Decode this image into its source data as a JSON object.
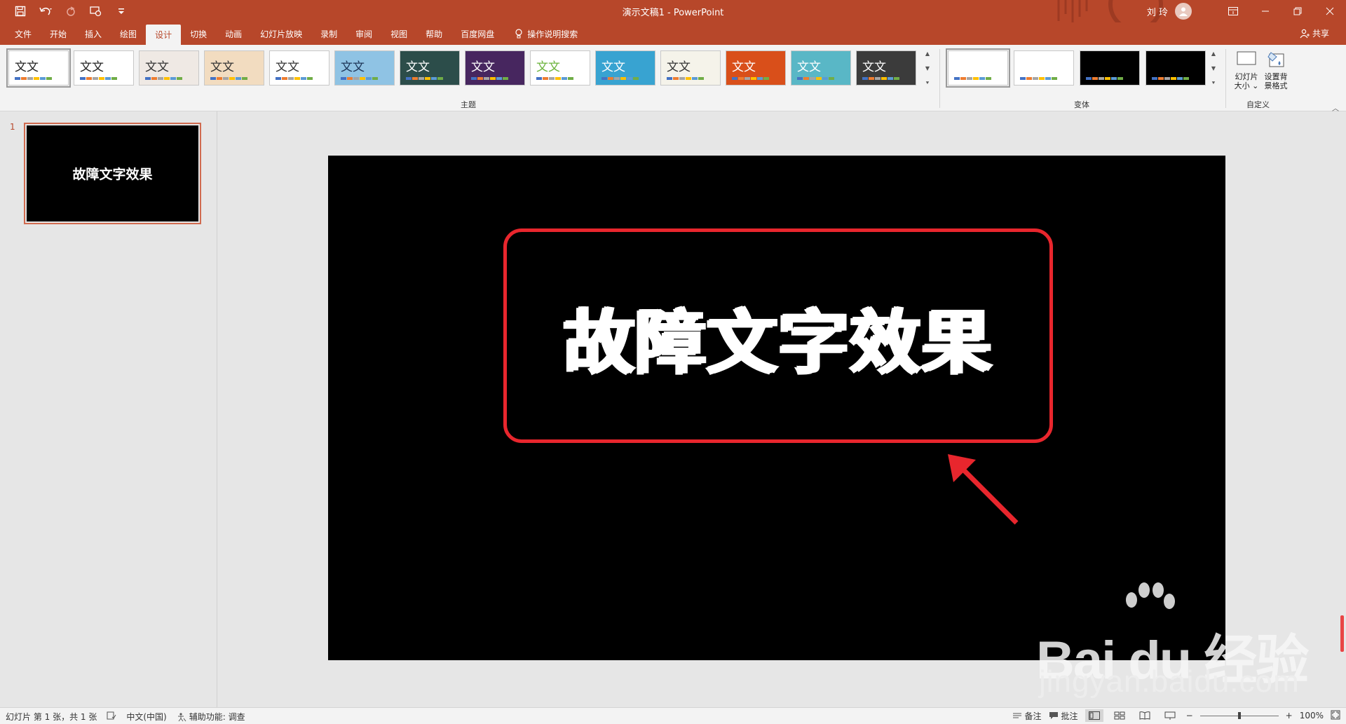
{
  "titlebar": {
    "doc_title": "演示文稿1  -  PowerPoint",
    "user_name": "刘 玲",
    "qat_icons": [
      "save-icon",
      "undo-icon",
      "redo-icon",
      "touch-mode-icon",
      "customize-qat-icon"
    ],
    "window_controls": [
      "ribbon-display-options-icon",
      "minimize-icon",
      "restore-icon",
      "close-icon"
    ]
  },
  "tabs": {
    "items": [
      "文件",
      "开始",
      "插入",
      "绘图",
      "设计",
      "切换",
      "动画",
      "幻灯片放映",
      "录制",
      "审阅",
      "视图",
      "帮助",
      "百度网盘"
    ],
    "active_index": 4,
    "tell_me": "操作说明搜索",
    "share": "共享"
  },
  "ribbon": {
    "themes_group_label": "主题",
    "variants_group_label": "变体",
    "customize_group_label": "自定义",
    "slide_size_label_line1": "幻灯片",
    "slide_size_label_line2": "大小",
    "format_bg_label_line1": "设置背",
    "format_bg_label_line2": "景格式",
    "themes": [
      {
        "label": "文文",
        "bg": "#ffffff",
        "fg": "#222222"
      },
      {
        "label": "文文",
        "bg": "#ffffff",
        "fg": "#222222"
      },
      {
        "label": "文文",
        "bg": "#efe9e4",
        "fg": "#333333"
      },
      {
        "label": "文文",
        "bg": "#f2dcc0",
        "fg": "#333333"
      },
      {
        "label": "文文",
        "bg": "#ffffff",
        "fg": "#333333"
      },
      {
        "label": "文文",
        "bg": "#8fc3e4",
        "fg": "#1d3557"
      },
      {
        "label": "文文",
        "bg": "#2c4d4a",
        "fg": "#ffffff"
      },
      {
        "label": "文文",
        "bg": "#47265f",
        "fg": "#ffffff"
      },
      {
        "label": "文文",
        "bg": "#ffffff",
        "fg": "#6bb33b"
      },
      {
        "label": "文文",
        "bg": "#38a3d1",
        "fg": "#ffffff"
      },
      {
        "label": "文文",
        "bg": "#f5f3ea",
        "fg": "#333333"
      },
      {
        "label": "文文",
        "bg": "#d94f1a",
        "fg": "#ffffff"
      },
      {
        "label": "文文",
        "bg": "#59b7c6",
        "fg": "#ffffff"
      },
      {
        "label": "文文",
        "bg": "#3b3b3b",
        "fg": "#ffffff"
      }
    ],
    "variants": [
      {
        "bg": "#ffffff"
      },
      {
        "bg": "#ffffff"
      },
      {
        "bg": "#000000"
      },
      {
        "bg": "#000000"
      }
    ],
    "swatch_colors": [
      "#4472c4",
      "#ed7d31",
      "#a5a5a5",
      "#ffc000",
      "#5b9bd5",
      "#70ad47"
    ]
  },
  "thumbnails": {
    "slide_number": "1",
    "thumb_text": "故障文字效果"
  },
  "slide": {
    "title": "故障文字效果",
    "highlight_color": "#e8262d"
  },
  "watermark": {
    "main": "Bai du 经验",
    "url": "jingyan.baidu.com"
  },
  "statusbar": {
    "slide_info": "幻灯片 第 1 张，共 1 张",
    "language": "中文(中国)",
    "accessibility": "辅助功能: 调查",
    "notes": "备注",
    "comments": "批注",
    "zoom_minus": "−",
    "zoom_plus": "+",
    "zoom_level": "100%",
    "zoom_fraction": 0.5
  },
  "colors": {
    "brand": "#b7472a",
    "ribbon_bg": "#f3f3f3",
    "workspace_bg": "#e6e6e6"
  }
}
